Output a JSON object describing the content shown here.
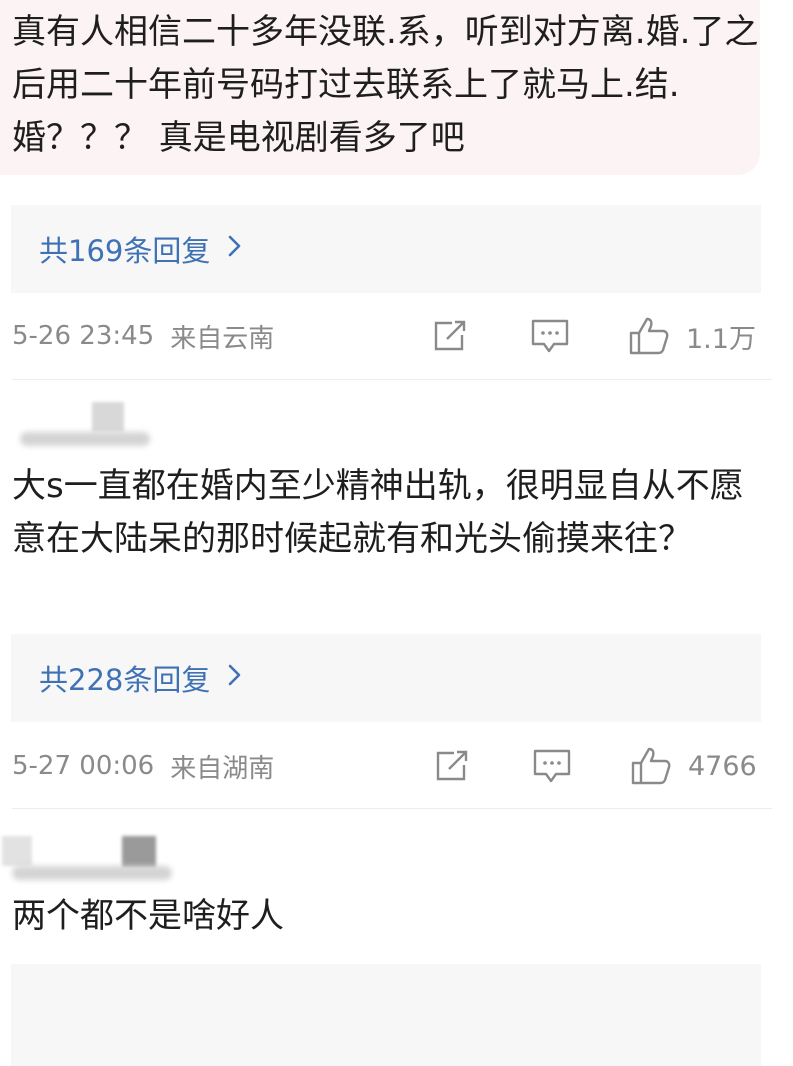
{
  "comments": [
    {
      "text": "真有人相信二十多年没联.系，听到对方离.婚.了之后用二十年前号码打过去联系上了就马上.结.婚？？？ 真是电视剧看多了吧",
      "reply_label": "共169条回复",
      "time": "5-26 23:45",
      "location": "来自云南",
      "likes": "1.1万"
    },
    {
      "text": "大s一直都在婚内至少精神出轨，很明显自从不愿意在大陆呆的那时候起就有和光头偷摸来往？",
      "reply_label": "共228条回复",
      "time": "5-27 00:06",
      "location": "来自湖南",
      "likes": "4766"
    },
    {
      "text": "两个都不是啥好人"
    }
  ],
  "icons": {
    "share": "share-icon",
    "comment": "comment-icon",
    "like": "thumbs-up-icon",
    "chevron": "chevron-right-icon"
  },
  "colors": {
    "link": "#3f72b5",
    "meta": "#8a8a8a",
    "highlight": "#fcf3f4",
    "reply_bg": "#f7f7f7"
  }
}
